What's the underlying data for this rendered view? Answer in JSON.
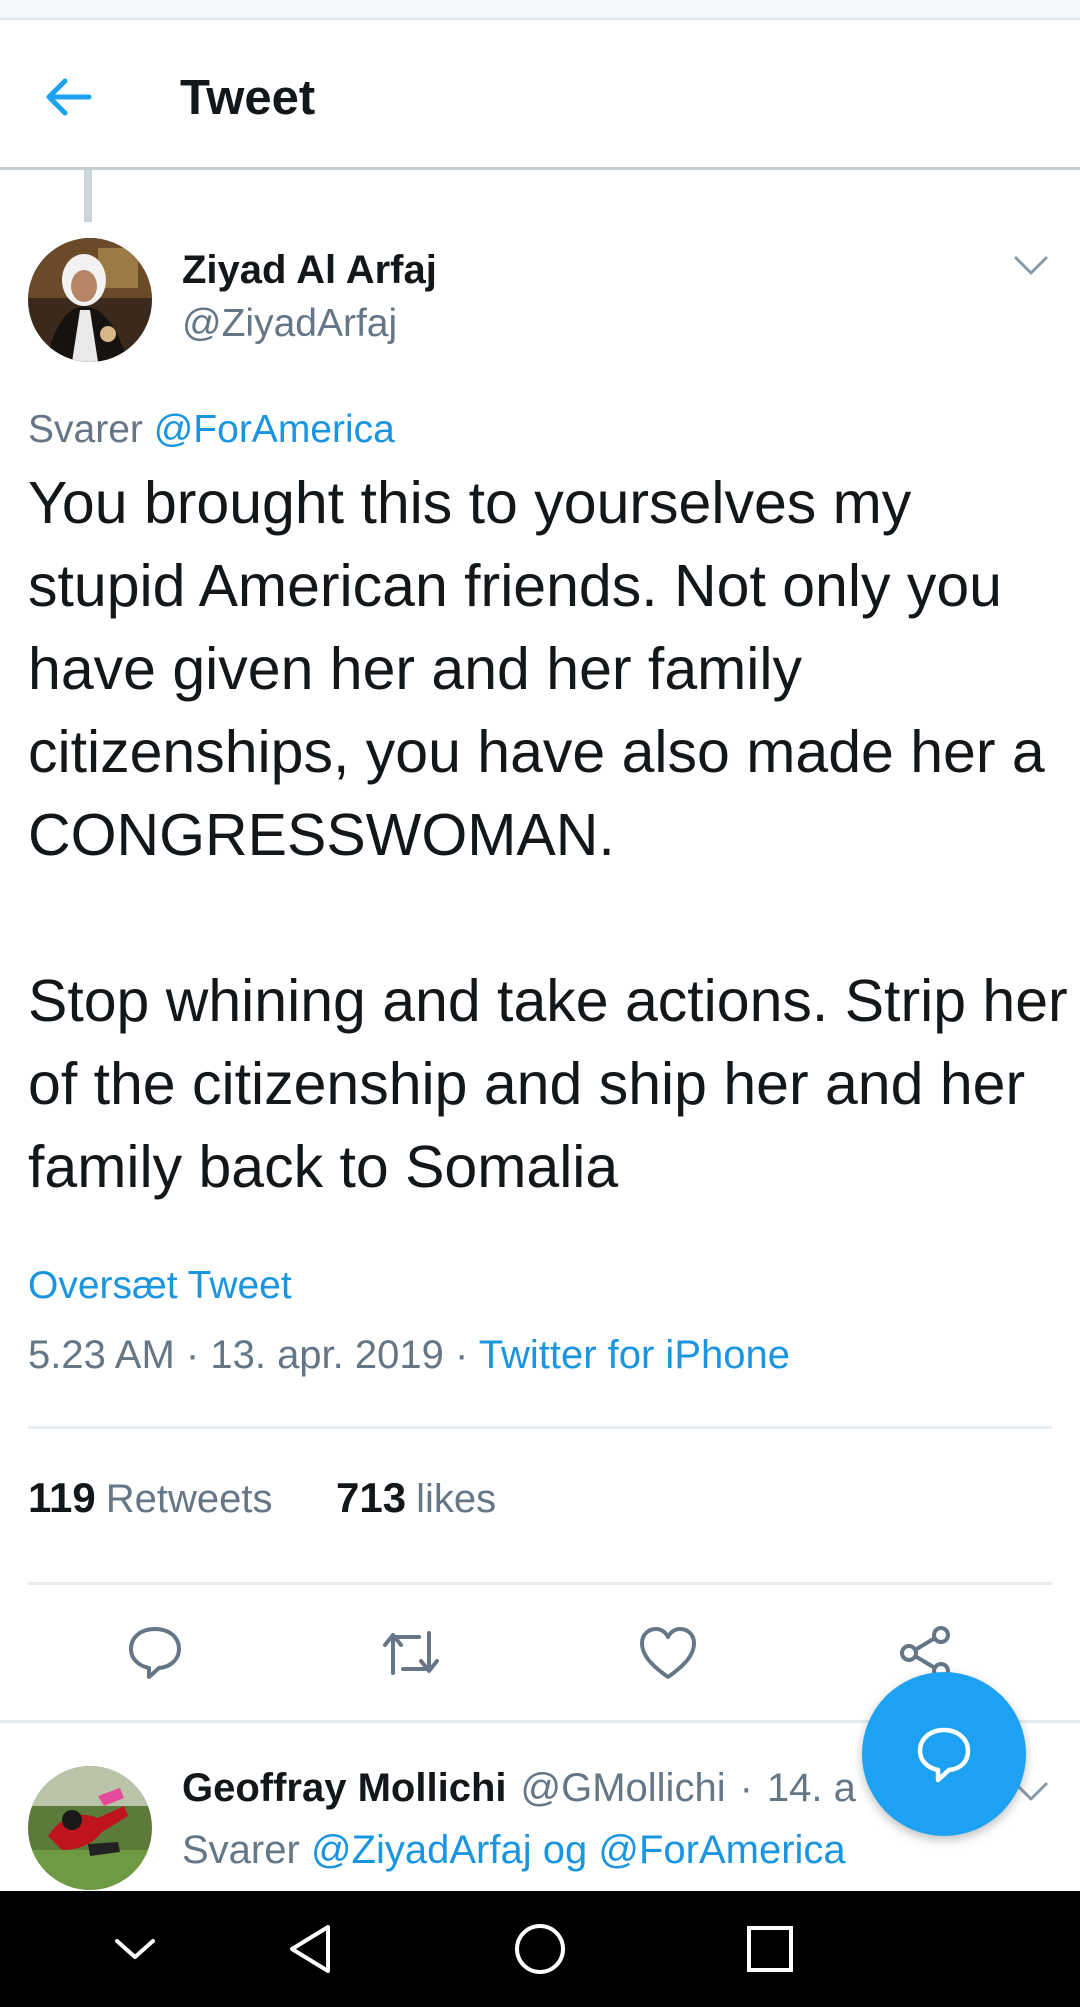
{
  "header": {
    "title": "Tweet",
    "back_icon": "arrow-left-icon"
  },
  "tweet": {
    "author_name": "Ziyad Al Arfaj",
    "author_handle": "@ZiyadArfaj",
    "replying_prefix": "Svarer",
    "replying_to": "@ForAmerica",
    "text": "You brought this to yourselves my stupid American friends. Not only you have given her and her family citizenships, you have also made her a CONGRESSWOMAN.\n\nStop whining and take actions. Strip her of the citizenship and ship her and her family back to Somalia",
    "translate_label": "Oversæt Tweet",
    "time": "5.23 AM",
    "date": "13. apr. 2019",
    "separator": "·",
    "source": "Twitter for iPhone",
    "retweets_count": "119",
    "retweets_label": "Retweets",
    "likes_count": "713",
    "likes_label": "likes"
  },
  "actions": [
    "reply-icon",
    "retweet-icon",
    "like-icon",
    "share-icon"
  ],
  "reply": {
    "author_name": "Geoffray Mollichi",
    "author_handle": "@GMollichi",
    "separator": "·",
    "date": "14. a",
    "replying_prefix": "Svarer",
    "replying_to_1": "@ZiyadArfaj",
    "replying_joiner": "og",
    "replying_to_2": "@ForAmerica"
  },
  "fab_icon": "compose-reply-icon",
  "navbar": [
    "chevron-down-icon",
    "back-triangle-icon",
    "home-circle-icon",
    "recents-square-icon"
  ],
  "colors": {
    "accent": "#1da1f2",
    "link": "#1b95e0",
    "text": "#14171a",
    "secondary": "#657786"
  }
}
